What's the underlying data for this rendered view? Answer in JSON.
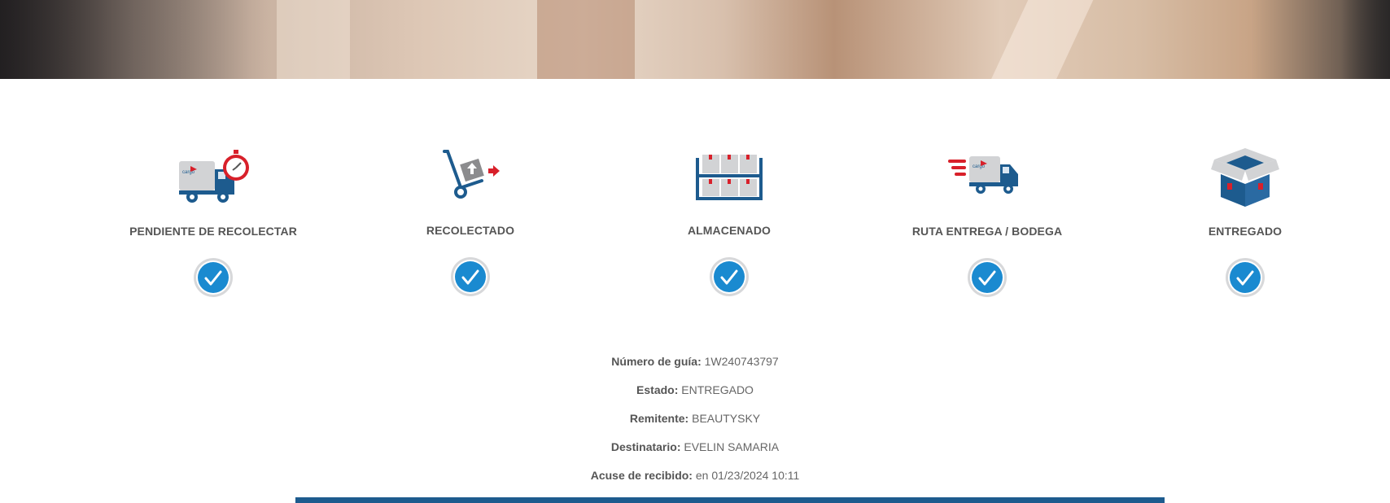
{
  "steps": [
    {
      "label": "PENDIENTE DE RECOLECTAR",
      "icon": "truck-stopwatch-icon",
      "completed": true
    },
    {
      "label": "RECOLECTADO",
      "icon": "hand-truck-icon",
      "completed": true
    },
    {
      "label": "ALMACENADO",
      "icon": "warehouse-shelf-icon",
      "completed": true
    },
    {
      "label": "RUTA ENTREGA / BODEGA",
      "icon": "fast-truck-icon",
      "completed": true
    },
    {
      "label": "ENTREGADO",
      "icon": "box-delivered-icon",
      "completed": true
    }
  ],
  "shipment": {
    "guide_label": "Número de guía:",
    "guide_value": "1W240743797",
    "status_label": "Estado:",
    "status_value": "ENTREGADO",
    "sender_label": "Remitente:",
    "sender_value": "BEAUTYSKY",
    "recipient_label": "Destinatario:",
    "recipient_value": "EVELIN SAMARIA",
    "receipt_label": "Acuse de recibido:",
    "receipt_value": "en 01/23/2024 10:11"
  },
  "truck_logo_text": "cargo expreso",
  "colors": {
    "accent_blue": "#1d5b8e",
    "check_blue": "#1a8ad0",
    "brand_red": "#d8202a",
    "label_gray": "#555555"
  }
}
